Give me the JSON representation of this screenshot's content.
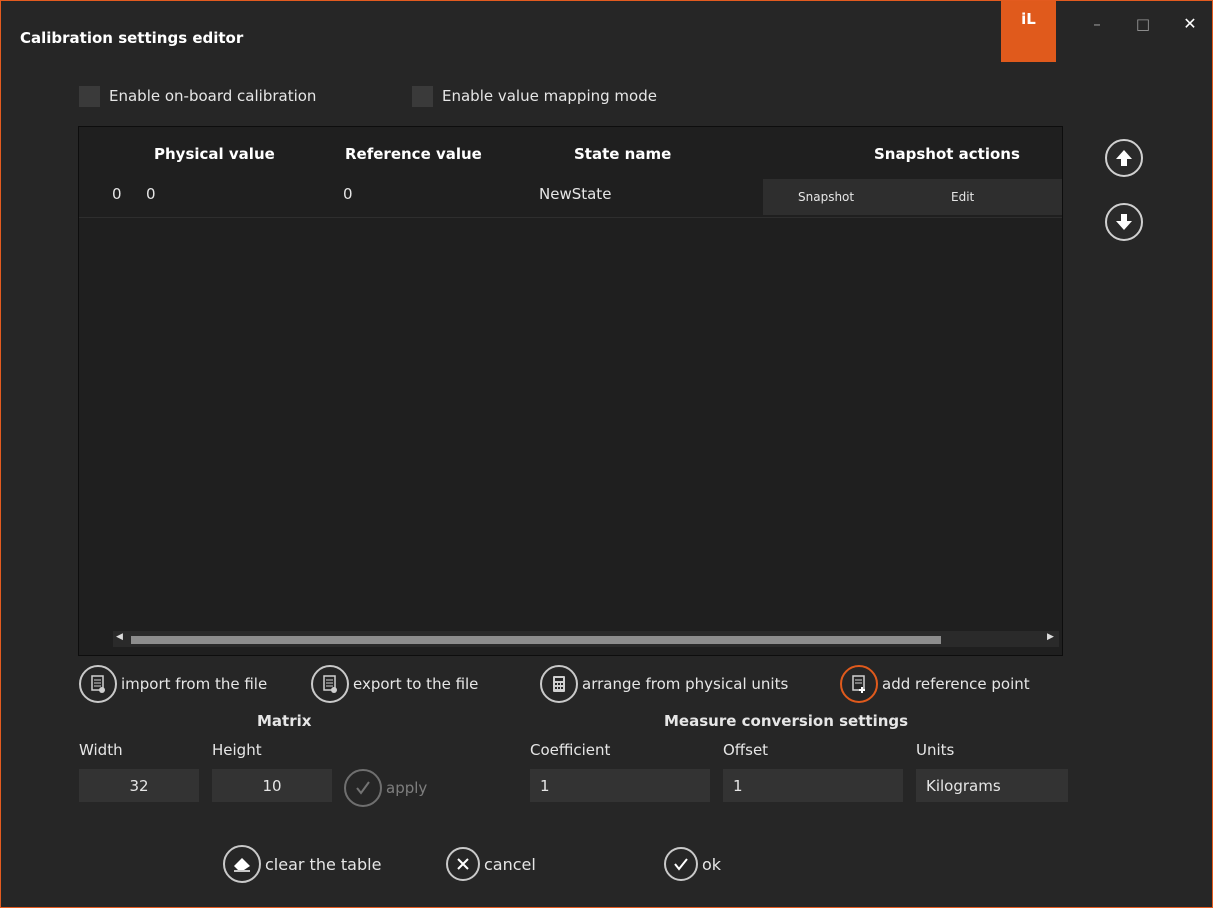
{
  "window": {
    "title": "Calibration settings editor",
    "brand": "iL",
    "minimize": "–",
    "maximize": "□",
    "close": "✕"
  },
  "checkboxes": {
    "onboard_label": "Enable on-board calibration",
    "mapping_label": "Enable value mapping mode"
  },
  "table": {
    "headers": {
      "physical": "Physical value",
      "reference": "Reference value",
      "state": "State name",
      "snapshot": "Snapshot actions"
    },
    "rows": [
      {
        "index": "0",
        "physical": "0",
        "reference": "0",
        "state": "NewState",
        "snapshot_btn": "Snapshot",
        "edit_btn": "Edit"
      }
    ]
  },
  "actions": {
    "import": "import from the file",
    "export": "export to the file",
    "arrange": "arrange from physical units",
    "add_point": "add reference point"
  },
  "matrix": {
    "title": "Matrix",
    "width_label": "Width",
    "height_label": "Height",
    "width_value": "32",
    "height_value": "10",
    "apply": "apply"
  },
  "conversion": {
    "title": "Measure conversion settings",
    "coefficient_label": "Coefficient",
    "offset_label": "Offset",
    "units_label": "Units",
    "coefficient_value": "1",
    "offset_value": "1",
    "units_value": "Kilograms"
  },
  "footer": {
    "clear": "clear the table",
    "cancel": "cancel",
    "ok": "ok"
  },
  "colors": {
    "accent": "#e05a1c",
    "background": "#262626",
    "table_bg": "#1f1f1f"
  }
}
